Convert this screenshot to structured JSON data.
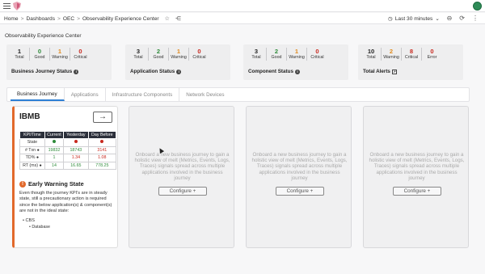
{
  "header": {
    "menu_icon": "hamburger-icon",
    "logo_icon": "shield-logo-icon",
    "avatar_icon": "user-avatar-icon"
  },
  "breadcrumb": {
    "items": [
      "Home",
      "Dashboards",
      "OEC",
      "Observability Experience Center"
    ],
    "separator": ">",
    "star_icon": "star-icon",
    "share_icon": "share-icon"
  },
  "toolbar": {
    "time_range": "Last 30 minutes",
    "clock_icon": "clock-icon",
    "chevron_icon": "chevron-down-icon",
    "zoom_icon": "zoom-out-icon",
    "refresh_icon": "refresh-icon",
    "more_icon": "more-vertical-icon"
  },
  "section_title": "Observability Experience Center",
  "summary": {
    "business_journey": {
      "title": "Business Journey Status",
      "metrics": [
        {
          "value": "1",
          "label": "Total",
          "color": "#222222"
        },
        {
          "value": "0",
          "label": "Good",
          "color": "#2e8b3a"
        },
        {
          "value": "1",
          "label": "Warning",
          "color": "#e08a1e"
        },
        {
          "value": "0",
          "label": "Critical",
          "color": "#c8281e"
        }
      ]
    },
    "application": {
      "title": "Application Status",
      "metrics": [
        {
          "value": "3",
          "label": "Total",
          "color": "#222222"
        },
        {
          "value": "2",
          "label": "Good",
          "color": "#2e8b3a"
        },
        {
          "value": "1",
          "label": "Warning",
          "color": "#e08a1e"
        },
        {
          "value": "0",
          "label": "Critical",
          "color": "#c8281e"
        }
      ]
    },
    "component": {
      "title": "Component Status",
      "metrics": [
        {
          "value": "3",
          "label": "Total",
          "color": "#222222"
        },
        {
          "value": "2",
          "label": "Good",
          "color": "#2e8b3a"
        },
        {
          "value": "1",
          "label": "Warning",
          "color": "#e08a1e"
        },
        {
          "value": "0",
          "label": "Critical",
          "color": "#c8281e"
        }
      ]
    },
    "alerts": {
      "title": "Total Alerts",
      "metrics": [
        {
          "value": "10",
          "label": "Total",
          "color": "#222222"
        },
        {
          "value": "2",
          "label": "Warning",
          "color": "#e08a1e"
        },
        {
          "value": "8",
          "label": "Critical",
          "color": "#c8281e"
        },
        {
          "value": "0",
          "label": "Error",
          "color": "#c8281e"
        }
      ]
    }
  },
  "tabs": [
    "Business Journey",
    "Applications",
    "Infrastructure Components",
    "Network Devices"
  ],
  "journey": {
    "name": "IBMB",
    "arrow_icon": "arrow-right-icon",
    "table": {
      "headers": [
        "KPI/Time",
        "Current",
        "Yesterday",
        "Day Before"
      ],
      "rows": [
        {
          "label": "State",
          "values": [
            "",
            "",
            ""
          ],
          "kind": "dots",
          "dot_colors": [
            "#2e8b3a",
            "#c8281e",
            "#c8281e"
          ]
        },
        {
          "label": "# Txn",
          "values": [
            "19832",
            "18743",
            "3141"
          ],
          "colors": [
            "#2e8b3a",
            "#2e8b3a",
            "#c8281e"
          ]
        },
        {
          "label": "TD%",
          "values": [
            "1",
            "1.34",
            "1.08"
          ],
          "colors": [
            "#2e8b3a",
            "#c8281e",
            "#c8281e"
          ]
        },
        {
          "label": "RT (ms)",
          "values": [
            "14",
            "16.65",
            "778.25"
          ],
          "colors": [
            "#2e8b3a",
            "#2e8b3a",
            "#2e8b3a"
          ]
        }
      ]
    },
    "warning": {
      "icon": "alert-circle-icon",
      "title": "Early Warning State",
      "text": "Even though the journey KPI's are in steady state, still a precautionary action is required since the below application(s) & component(s) are not in the ideal state:",
      "list": [
        "CBS"
      ],
      "sublist": [
        "Database"
      ]
    }
  },
  "onboard": {
    "text": "Onboard a new business journey to gain a holistic view of melt (Metrics, Events, Logs, Traces) signals spread across multiple applications involved in the business journey",
    "button": "Configure +"
  }
}
